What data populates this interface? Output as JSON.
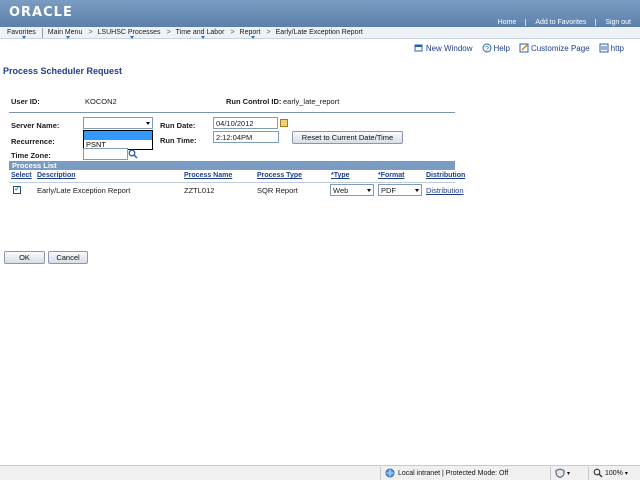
{
  "banner": {
    "logo": "ORACLE",
    "links": [
      "Home",
      "Add to Favorites",
      "Sign out"
    ]
  },
  "menubar": {
    "items": [
      "Favorites",
      "Main Menu",
      "LSUHSC Processes",
      "Time and Labor",
      "Report",
      "Early/Late Exception Report"
    ]
  },
  "pagebar": {
    "new_window": "New Window",
    "help": "Help",
    "customize": "Customize Page",
    "http": "http"
  },
  "page": {
    "title": "Process Scheduler Request"
  },
  "form": {
    "user_id_label": "User ID:",
    "user_id": "KOCON2",
    "run_control_label": "Run Control ID:",
    "run_control": "early_late_report",
    "server_name_label": "Server Name:",
    "server_name_value": "",
    "server_options": [
      "",
      "PSNT"
    ],
    "recurrence_label": "Recurrence:",
    "time_zone_label": "Time Zone:",
    "run_date_label": "Run Date:",
    "run_date": "04/10/2012",
    "run_time_label": "Run Time:",
    "run_time": "2:12:04PM",
    "reset_button": "Reset to Current Date/Time"
  },
  "process_list": {
    "title": "Process List",
    "headers": [
      "Select",
      "Description",
      "Process Name",
      "Process Type",
      "*Type",
      "*Format",
      "Distribution"
    ],
    "rows": [
      {
        "description": "Early/Late Exception Report",
        "process_name": "ZZTL012",
        "process_type": "SQR Report",
        "type": "Web",
        "format": "PDF",
        "distribution": "Distribution"
      }
    ]
  },
  "buttons": {
    "ok": "OK",
    "cancel": "Cancel"
  },
  "statusbar": {
    "zone": "Local intranet | Protected Mode: Off",
    "zoom": "100%"
  }
}
